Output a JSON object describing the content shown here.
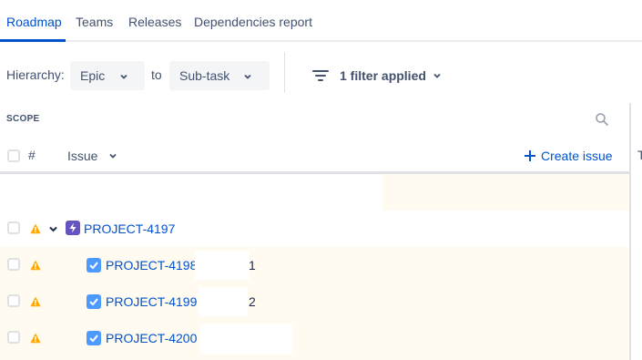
{
  "tabs": [
    {
      "label": "Roadmap",
      "active": true
    },
    {
      "label": "Teams",
      "active": false
    },
    {
      "label": "Releases",
      "active": false
    },
    {
      "label": "Dependencies report",
      "active": false
    }
  ],
  "controls": {
    "hierarchy_label": "Hierarchy:",
    "from_value": "Epic",
    "to_label": "to",
    "to_value": "Sub-task",
    "filter_label": "1 filter applied"
  },
  "table": {
    "scope_label": "SCOPE",
    "hash_label": "#",
    "issue_label": "Issue",
    "create_label": "Create issue",
    "cut_col_label": "T"
  },
  "rows": [
    {
      "key": "PROJECT-4197",
      "type": "epic",
      "warning": true
    },
    {
      "key": "PROJECT-4198",
      "type": "sub-task",
      "warning": true,
      "fragment": "1"
    },
    {
      "key": "PROJECT-4199",
      "type": "sub-task",
      "warning": true,
      "fragment": "2"
    },
    {
      "key": "PROJECT-4200",
      "type": "sub-task",
      "warning": true,
      "fragment": ""
    }
  ],
  "colors": {
    "accent": "#0052cc",
    "warning": "#ffab00",
    "epic": "#6554c0",
    "subtask": "#4c9aff",
    "row_highlight": "#fffbf0"
  }
}
